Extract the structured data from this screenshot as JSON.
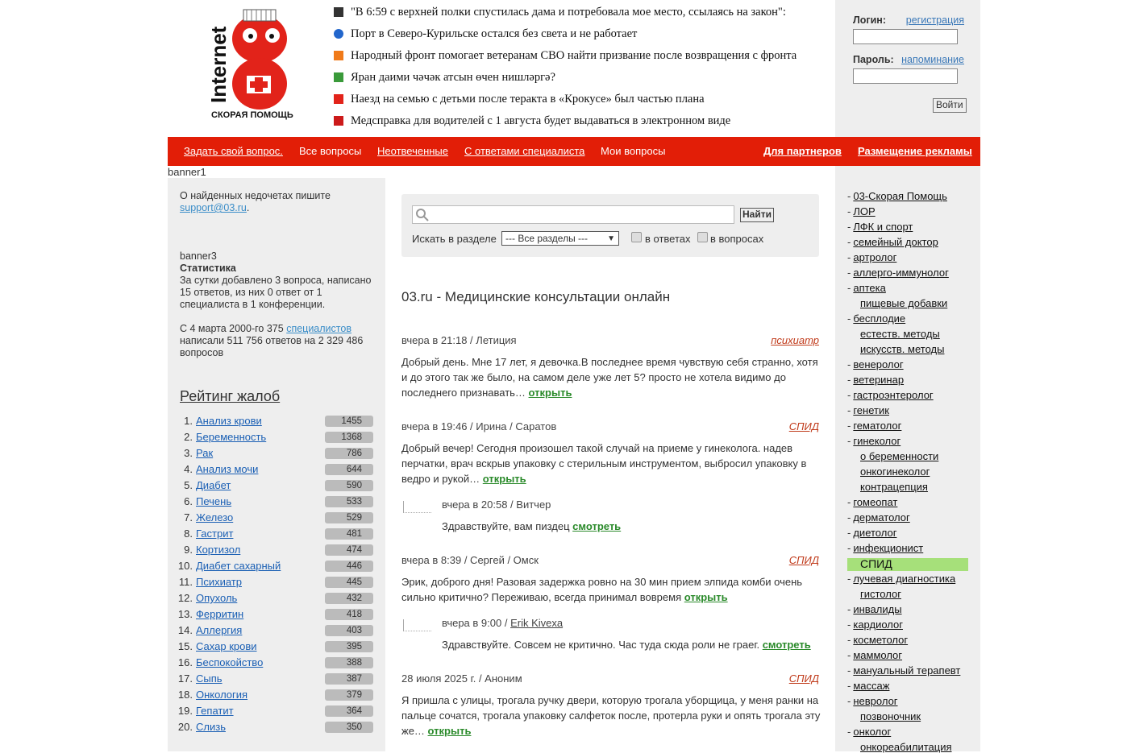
{
  "logo": {
    "top_text": "Internet",
    "bottom_text": "СКОРАЯ ПОМОЩЬ"
  },
  "news": [
    {
      "icon": "p-badge-icon",
      "text": "\"В 6:59 с верхней полки спустилась дама и потребовала мое место, ссылаясь на закон\":"
    },
    {
      "icon": "globe-icon",
      "text": "Порт в Северо-Курильске остался без света и не работает"
    },
    {
      "icon": "orange-leaf-icon",
      "text": "Народный фронт помогает ветеранам СВО найти призвание после возвращения с фронта"
    },
    {
      "icon": "green-logo-icon",
      "text": "Яран даими чәчәк атсын өчен нишләргә?"
    },
    {
      "icon": "star-icon",
      "text": "Наезд на семью с детьми после теракта в «Крокусе» был частью плана"
    },
    {
      "icon": "red-logo-icon",
      "text": "Медсправка для водителей с 1 августа будет выдаваться в электронном виде"
    }
  ],
  "login": {
    "login_label": "Логин:",
    "register_link": "регистрация",
    "password_label": "Пароль:",
    "remind_link": "напоминание",
    "submit": "Войти"
  },
  "nav": {
    "ask": "Задать свой вопрос.",
    "all": "Все вопросы",
    "unanswered": "Неотвеченные",
    "with_answers": "С ответами специалиста",
    "mine": "Мои вопросы",
    "partners": "Для партнеров",
    "ads": "Размещение рекламы"
  },
  "banner1": "banner1",
  "left": {
    "notice": "О найденных недочетах пишите",
    "email": "support@03.ru",
    "banner3": "banner3",
    "stats_title": "Статистика",
    "stats_day": "За сутки добавлено 3 вопроса, написано 15 ответов, из них 0 ответ от 1 специалиста в 1 конференции.",
    "stats_since_pre": "С 4 марта 2000-го 375",
    "stats_specialists": "специалистов",
    "stats_since_post": "написали 511 756 ответов на 2 329 486 вопросов",
    "rating_title": "Рейтинг жалоб"
  },
  "rating": [
    {
      "num": "1.",
      "name": "Анализ крови",
      "count": "1455"
    },
    {
      "num": "2.",
      "name": "Беременность",
      "count": "1368"
    },
    {
      "num": "3.",
      "name": "Рак",
      "count": "786"
    },
    {
      "num": "4.",
      "name": "Анализ мочи",
      "count": "644"
    },
    {
      "num": "5.",
      "name": "Диабет",
      "count": "590"
    },
    {
      "num": "6.",
      "name": "Печень",
      "count": "533"
    },
    {
      "num": "7.",
      "name": "Железо",
      "count": "529"
    },
    {
      "num": "8.",
      "name": "Гастрит",
      "count": "481"
    },
    {
      "num": "9.",
      "name": "Кортизол",
      "count": "474"
    },
    {
      "num": "10.",
      "name": "Диабет сахарный",
      "count": "446"
    },
    {
      "num": "11.",
      "name": "Психиатр",
      "count": "445"
    },
    {
      "num": "12.",
      "name": "Опухоль",
      "count": "432"
    },
    {
      "num": "13.",
      "name": "Ферритин",
      "count": "418"
    },
    {
      "num": "14.",
      "name": "Аллергия",
      "count": "403"
    },
    {
      "num": "15.",
      "name": "Сахар крови",
      "count": "395"
    },
    {
      "num": "16.",
      "name": "Беспокойство",
      "count": "388"
    },
    {
      "num": "17.",
      "name": "Сыпь",
      "count": "387"
    },
    {
      "num": "18.",
      "name": "Онкология",
      "count": "379"
    },
    {
      "num": "19.",
      "name": "Гепатит",
      "count": "364"
    },
    {
      "num": "20.",
      "name": "Слизь",
      "count": "350"
    }
  ],
  "search": {
    "button": "Найти",
    "section_label": "Искать в разделе",
    "section_value": "--- Все разделы ---",
    "in_answers": "в ответах",
    "in_questions": "в вопросах"
  },
  "main": {
    "title": "03.ru - Медицинские консультации онлайн",
    "questions": [
      {
        "meta": "вчера в 21:18 / Летиция",
        "category": "психиатр",
        "text": "Добрый день. Мне 17 лет, я девочка.В последнее время чувствую себя странно, хотя и до этого так же было, на самом деле уже лет 5? просто не хотела видимо до последнего признавать…",
        "open": "открыть"
      },
      {
        "meta": "вчера в 19:46 / Ирина / Саратов",
        "category": "СПИД",
        "text": "Добрый вечер! Сегодня произошел такой случай на приеме у гинеколога. надев перчатки, врач вскрыв упаковку с стерильным инструментом, выбросил упаковку в ведро и рукой…",
        "open": "открыть",
        "answer": {
          "meta": "вчера в 20:58 / Витчер",
          "author": "",
          "text": "Здравствуйте, вам пиздец",
          "view": "смотреть"
        }
      },
      {
        "meta": "вчера в 8:39 / Сергей / Омск",
        "category": "СПИД",
        "text": "Эрик, доброго дня! Разовая задержка ровно на 30 мин прием элпида комби очень сильно критично? Переживаю, всегда принимал вовремя",
        "open": "открыть",
        "answer": {
          "meta": "вчера в 9:00 / ",
          "author": "Erik Kivexa",
          "text": "Здравствуйте. Совсем не критично. Час туда сюда роли не граег.",
          "view": "смотреть"
        }
      },
      {
        "meta": "28 июля 2025 г. / Аноним",
        "category": "СПИД",
        "text": "Я пришла с улицы, трогала ручку двери, которую трогала уборщица, у меня ранки на пальце сочатся, трогала упаковку салфеток после, протерла руки и опять трогала эту же…",
        "open": "открыть"
      }
    ]
  },
  "sections": [
    {
      "label": "03-Скорая Помощь",
      "sub": false
    },
    {
      "label": "ЛОР",
      "sub": false
    },
    {
      "label": "ЛФК и спорт",
      "sub": false
    },
    {
      "label": "семейный доктор",
      "sub": false
    },
    {
      "label": "артролог",
      "sub": false
    },
    {
      "label": "аллерго-иммунолог",
      "sub": false
    },
    {
      "label": "аптека",
      "sub": false
    },
    {
      "label": "пищевые добавки",
      "sub": true
    },
    {
      "label": "бесплодие",
      "sub": false
    },
    {
      "label": "естеств. методы",
      "sub": true
    },
    {
      "label": "искусств. методы",
      "sub": true
    },
    {
      "label": "венеролог",
      "sub": false
    },
    {
      "label": "ветеринар",
      "sub": false
    },
    {
      "label": "гастроэнтеролог",
      "sub": false
    },
    {
      "label": "генетик",
      "sub": false
    },
    {
      "label": "гематолог",
      "sub": false
    },
    {
      "label": "гинеколог",
      "sub": false
    },
    {
      "label": "о беременности",
      "sub": true
    },
    {
      "label": "онкогинеколог",
      "sub": true
    },
    {
      "label": "контрацепция",
      "sub": true
    },
    {
      "label": "гомеопат",
      "sub": false
    },
    {
      "label": "дерматолог",
      "sub": false
    },
    {
      "label": "диетолог",
      "sub": false
    },
    {
      "label": "инфекционист",
      "sub": false
    },
    {
      "label": "СПИД",
      "sub": true,
      "active": true
    },
    {
      "label": "лучевая диагностика",
      "sub": false
    },
    {
      "label": "гистолог",
      "sub": true
    },
    {
      "label": "инвалиды",
      "sub": false
    },
    {
      "label": "кардиолог",
      "sub": false
    },
    {
      "label": "косметолог",
      "sub": false
    },
    {
      "label": "маммолог",
      "sub": false
    },
    {
      "label": "мануальный терапевт",
      "sub": false
    },
    {
      "label": "массаж",
      "sub": false
    },
    {
      "label": "невролог",
      "sub": false
    },
    {
      "label": "позвоночник",
      "sub": true
    },
    {
      "label": "онколог",
      "sub": false
    },
    {
      "label": "онкореабилитация",
      "sub": true
    }
  ],
  "colors": {
    "nav_red": "#e21e07",
    "active_section": "#a6e07a",
    "open_link": "#2a8a2a",
    "category": "#c03a1a"
  }
}
